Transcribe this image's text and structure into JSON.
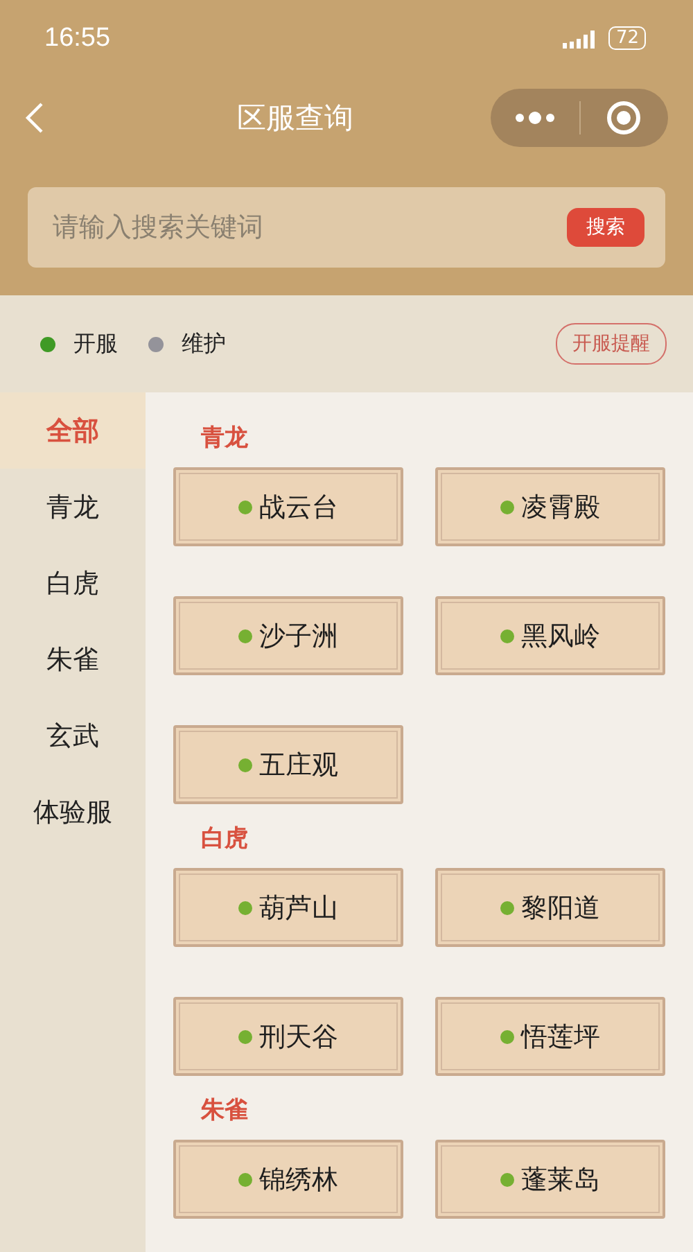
{
  "status_bar": {
    "time": "16:55",
    "battery": "72"
  },
  "nav": {
    "title": "区服查询"
  },
  "search": {
    "placeholder": "请输入搜索关键词",
    "button": "搜索"
  },
  "legend": [
    {
      "label": "开服",
      "color": "#3f9a25"
    },
    {
      "label": "维护",
      "color": "#94939a"
    }
  ],
  "remind_button": "开服提醒",
  "sidebar": {
    "items": [
      {
        "label": "全部",
        "selected": true
      },
      {
        "label": "青龙",
        "selected": false
      },
      {
        "label": "白虎",
        "selected": false
      },
      {
        "label": "朱雀",
        "selected": false
      },
      {
        "label": "玄武",
        "selected": false
      },
      {
        "label": "体验服",
        "selected": false
      }
    ]
  },
  "sections": [
    {
      "title": "青龙",
      "servers": [
        {
          "name": "战云台",
          "color": "#76b032"
        },
        {
          "name": "凌霄殿",
          "color": "#76b032"
        },
        {
          "name": "沙子洲",
          "color": "#76b032"
        },
        {
          "name": "黑风岭",
          "color": "#76b032"
        },
        {
          "name": "五庄观",
          "color": "#76b032"
        }
      ]
    },
    {
      "title": "白虎",
      "servers": [
        {
          "name": "葫芦山",
          "color": "#76b032"
        },
        {
          "name": "黎阳道",
          "color": "#76b032"
        },
        {
          "name": "刑天谷",
          "color": "#76b032"
        },
        {
          "name": "悟莲坪",
          "color": "#76b032"
        }
      ]
    },
    {
      "title": "朱雀",
      "servers": [
        {
          "name": "锦绣林",
          "color": "#76b032"
        },
        {
          "name": "蓬莱岛",
          "color": "#76b032"
        }
      ]
    }
  ]
}
